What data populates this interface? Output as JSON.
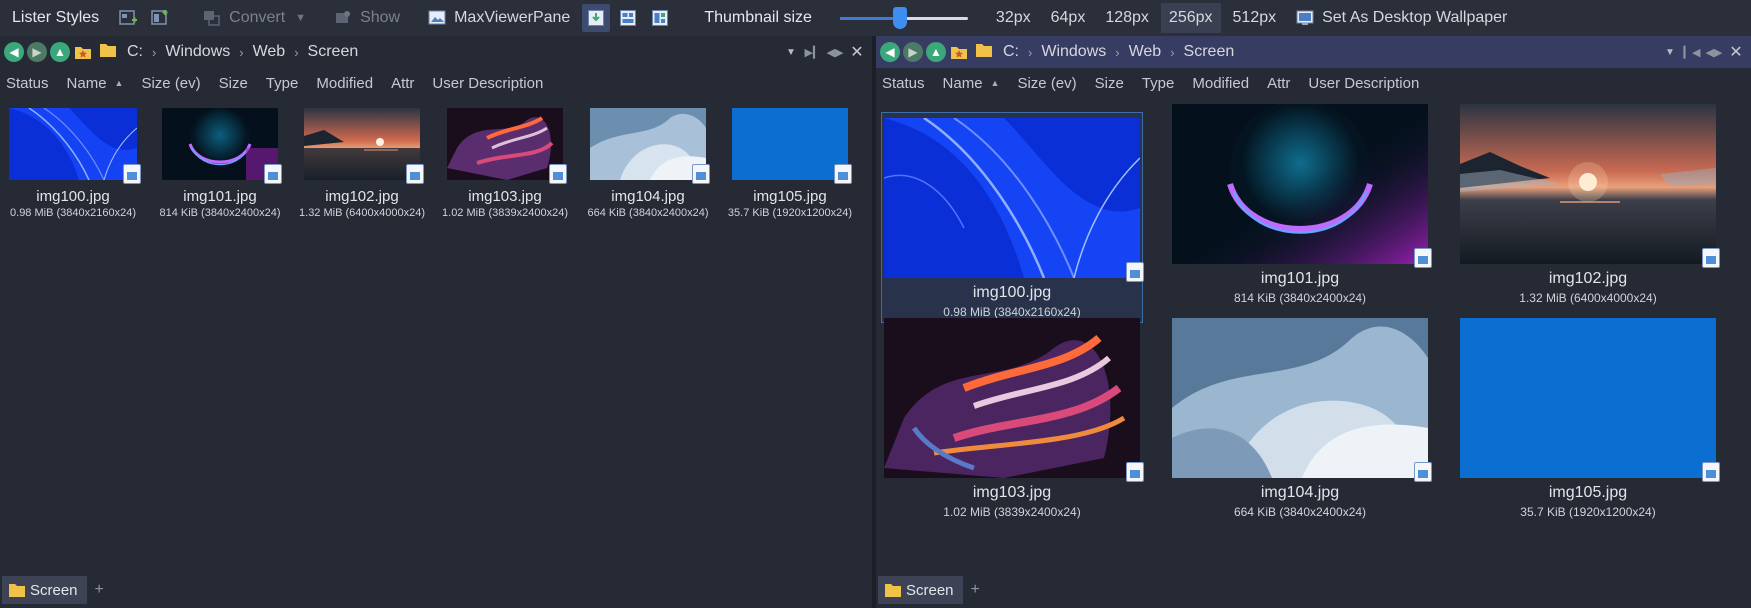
{
  "toolbar": {
    "lister_styles": "Lister Styles",
    "convert": "Convert",
    "show": "Show",
    "max_viewer_pane": "MaxViewerPane",
    "thumbnail_size_label": "Thumbnail size",
    "thumbnail_slider_value": 0.47,
    "sizes": [
      "32px",
      "64px",
      "128px",
      "256px",
      "512px"
    ],
    "selected_size": "256px",
    "set_wallpaper": "Set As Desktop Wallpaper"
  },
  "left_pane": {
    "breadcrumb": [
      "C:",
      "Windows",
      "Web",
      "Screen"
    ],
    "columns": [
      "Status",
      "Name",
      "Size (ev)",
      "Size",
      "Type",
      "Modified",
      "Attr",
      "User Description"
    ],
    "sort_column": "Name",
    "files": [
      {
        "name": "img100.jpg",
        "meta": "0.98 MiB (3840x2160x24)"
      },
      {
        "name": "img101.jpg",
        "meta": "814 KiB (3840x2400x24)"
      },
      {
        "name": "img102.jpg",
        "meta": "1.32 MiB (6400x4000x24)"
      },
      {
        "name": "img103.jpg",
        "meta": "1.02 MiB (3839x2400x24)"
      },
      {
        "name": "img104.jpg",
        "meta": "664 KiB (3840x2400x24)"
      },
      {
        "name": "img105.jpg",
        "meta": "35.7 KiB (1920x1200x24)"
      }
    ],
    "tab_label": "Screen"
  },
  "right_pane": {
    "breadcrumb": [
      "C:",
      "Windows",
      "Web",
      "Screen"
    ],
    "columns": [
      "Status",
      "Name",
      "Size (ev)",
      "Size",
      "Type",
      "Modified",
      "Attr",
      "User Description"
    ],
    "sort_column": "Name",
    "selected_file": "img100.jpg",
    "files": [
      {
        "name": "img100.jpg",
        "meta": "0.98 MiB (3840x2160x24)"
      },
      {
        "name": "img101.jpg",
        "meta": "814 KiB (3840x2400x24)"
      },
      {
        "name": "img102.jpg",
        "meta": "1.32 MiB (6400x4000x24)"
      },
      {
        "name": "img103.jpg",
        "meta": "1.02 MiB (3839x2400x24)"
      },
      {
        "name": "img104.jpg",
        "meta": "664 KiB (3840x2400x24)"
      },
      {
        "name": "img105.jpg",
        "meta": "35.7 KiB (1920x1200x24)"
      }
    ],
    "tab_label": "Screen"
  },
  "icons": {
    "nav_back": "back-arrow-icon",
    "nav_forward": "forward-arrow-icon",
    "nav_up": "up-arrow-icon",
    "favorites": "star-folder-icon",
    "folder": "folder-icon",
    "close": "close-icon",
    "add_tab": "plus-icon"
  },
  "colors": {
    "background": "#262a34",
    "toolbar": "#2b2f3a",
    "active_pathbar": "#373c62",
    "accent": "#3e8ef0",
    "folder": "#f0c24a",
    "nav_green": "#3aa87a"
  }
}
